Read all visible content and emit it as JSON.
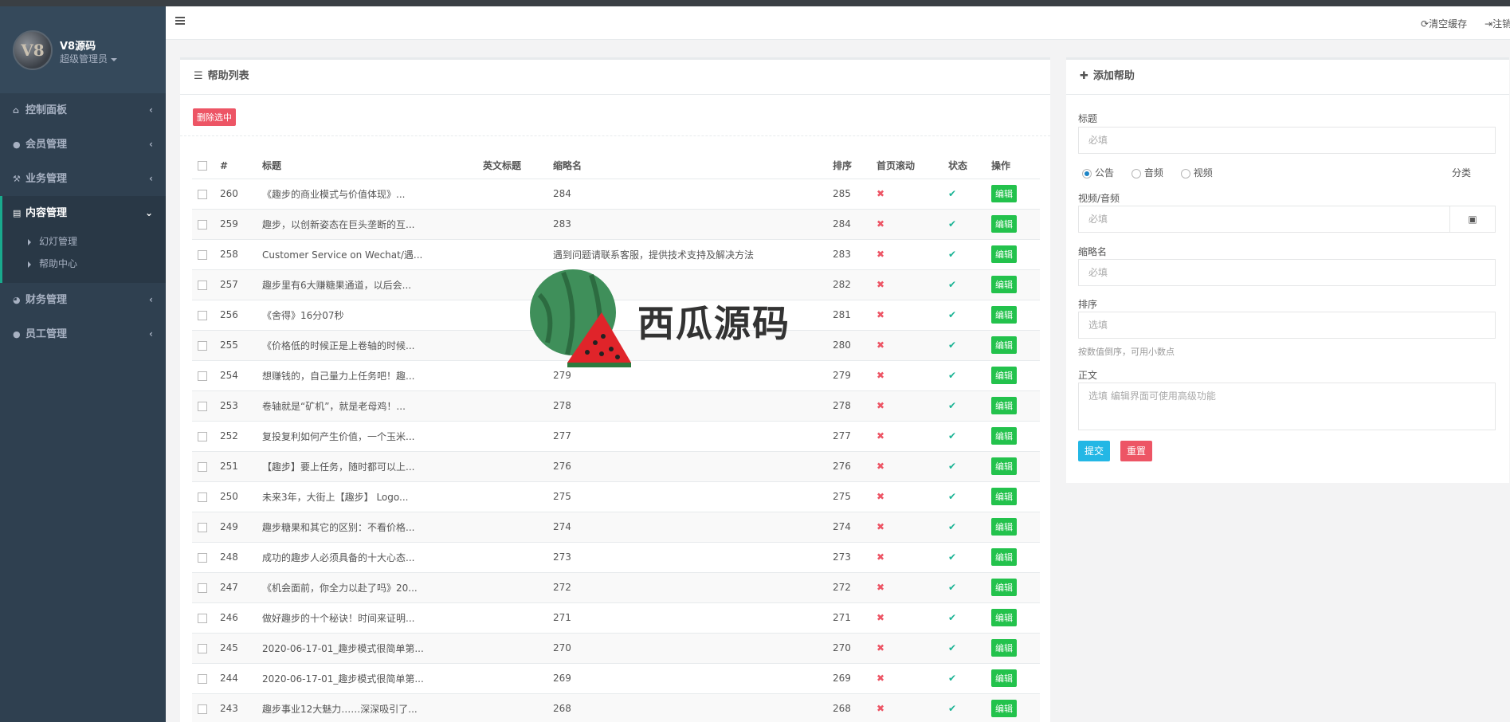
{
  "profile": {
    "name": "V8源码",
    "role": "超级管理员",
    "avatar_text": "V8"
  },
  "sidebar": {
    "items": [
      {
        "label": "控制面板",
        "icon": "home-icon"
      },
      {
        "label": "会员管理",
        "icon": "user-icon"
      },
      {
        "label": "业务管理",
        "icon": "gavel-icon"
      },
      {
        "label": "内容管理",
        "icon": "book-icon"
      },
      {
        "label": "财务管理",
        "icon": "pie-chart-icon"
      },
      {
        "label": "员工管理",
        "icon": "user-icon"
      }
    ],
    "sub_items": [
      {
        "label": "幻灯管理"
      },
      {
        "label": "帮助中心"
      }
    ]
  },
  "header": {
    "clear_cache": "清空缓存",
    "logout": "注销"
  },
  "list_panel": {
    "title": "帮助列表",
    "delete_selected": "删除选中",
    "columns": [
      "#",
      "标题",
      "英文标题",
      "缩略名",
      "排序",
      "首页滚动",
      "状态",
      "操作"
    ],
    "edit_label": "编辑",
    "rows": [
      {
        "id": "260",
        "title": "《趣步的商业模式与价值体现》...",
        "en_title": "",
        "slug": "284",
        "order": "285"
      },
      {
        "id": "259",
        "title": "趣步，以创新姿态在巨头垄断的互...",
        "en_title": "",
        "slug": "283",
        "order": "284"
      },
      {
        "id": "258",
        "title": "Customer Service on Wechat/遇...",
        "en_title": "",
        "slug": "遇到问题请联系客服，提供技术支持及解决方法",
        "order": "283"
      },
      {
        "id": "257",
        "title": "趣步里有6大赚糖果通道，以后会...",
        "en_title": "",
        "slug": "",
        "order": "282"
      },
      {
        "id": "256",
        "title": "《舍得》16分07秒",
        "en_title": "",
        "slug": "",
        "order": "281"
      },
      {
        "id": "255",
        "title": "《价格低的时候正是上卷轴的时候...",
        "en_title": "",
        "slug": "",
        "order": "280"
      },
      {
        "id": "254",
        "title": "想赚钱的，自己量力上任务吧！趣...",
        "en_title": "",
        "slug": "279",
        "order": "279"
      },
      {
        "id": "253",
        "title": "卷轴就是“矿机”，就是老母鸡！...",
        "en_title": "",
        "slug": "278",
        "order": "278"
      },
      {
        "id": "252",
        "title": "复投复利如何产生价值，一个玉米...",
        "en_title": "",
        "slug": "277",
        "order": "277"
      },
      {
        "id": "251",
        "title": "【趣步】要上任务，随时都可以上...",
        "en_title": "",
        "slug": "276",
        "order": "276"
      },
      {
        "id": "250",
        "title": "未来3年，大街上【趣步】 Logo...",
        "en_title": "",
        "slug": "275",
        "order": "275"
      },
      {
        "id": "249",
        "title": "趣步糖果和其它的区别：不看价格...",
        "en_title": "",
        "slug": "274",
        "order": "274"
      },
      {
        "id": "248",
        "title": "成功的趣步人必须具备的十大心态...",
        "en_title": "",
        "slug": "273",
        "order": "273"
      },
      {
        "id": "247",
        "title": "《机会面前，你全力以赴了吗》20...",
        "en_title": "",
        "slug": "272",
        "order": "272"
      },
      {
        "id": "246",
        "title": "做好趣步的十个秘诀！时间来证明...",
        "en_title": "",
        "slug": "271",
        "order": "271"
      },
      {
        "id": "245",
        "title": "2020-06-17-01_趣步模式很简单第...",
        "en_title": "",
        "slug": "270",
        "order": "270"
      },
      {
        "id": "244",
        "title": "2020-06-17-01_趣步模式很简单第...",
        "en_title": "",
        "slug": "269",
        "order": "269"
      },
      {
        "id": "243",
        "title": "趣步事业12大魅力……深深吸引了...",
        "en_title": "",
        "slug": "268",
        "order": "268"
      }
    ]
  },
  "form_panel": {
    "title": "添加帮助",
    "title_label": "标题",
    "title_placeholder": "必填",
    "radios": [
      "公告",
      "音频",
      "视频"
    ],
    "category_label": "分类",
    "media_label": "视频/音频",
    "media_placeholder": "必填",
    "slug_label": "缩略名",
    "slug_placeholder": "必填",
    "order_label": "排序",
    "order_placeholder": "选填",
    "order_hint": "按数值倒序，可用小数点",
    "body_label": "正文",
    "body_placeholder": "选填 编辑界面可使用高级功能",
    "submit": "提交",
    "reset": "重置"
  },
  "watermark": {
    "text": "西瓜源码"
  },
  "colors": {
    "sidebar": "#2f4050",
    "danger": "#ed5565",
    "success": "#23c24c",
    "primary": "#23b7e5",
    "check": "#1ab394"
  }
}
